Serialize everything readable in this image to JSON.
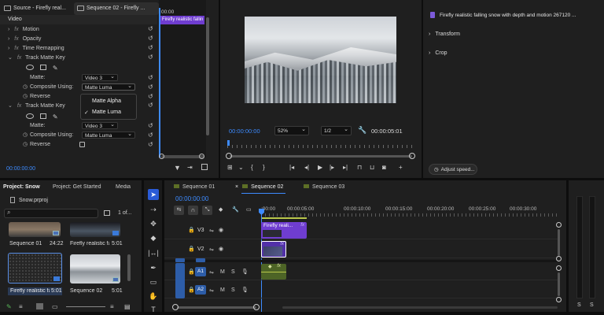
{
  "source_panel": {
    "tab_source": "Source - Firefly real...",
    "tab_sequence": "Sequence 02 - Firefly ...",
    "section_video": "Video",
    "effects": [
      {
        "label": "Motion"
      },
      {
        "label": "Opacity"
      },
      {
        "label": "Time Remapping"
      },
      {
        "label": "Track Matte Key"
      }
    ],
    "matte_label": "Matte:",
    "matte_value": "Video 3",
    "composite_label": "Composite Using:",
    "composite_value": "Matte Luma",
    "reverse_label": "Reverse",
    "track_matte_2": "Track Matte Key",
    "matte_value_2": "Video 3",
    "composite_value_2": "Matte Luma",
    "menu_items": [
      "Matte Alpha",
      "Matte Luma"
    ],
    "menu_checked": "Matte Luma",
    "timecode": "00:00:00:00",
    "mini_time": "00:00",
    "mini_clip": "Firefly realistic fallin"
  },
  "program": {
    "timecode": "00:00:00:00",
    "zoom": "52%",
    "resolution": "1/2",
    "duration": "00:00:05:01"
  },
  "properties": {
    "clip_title": "Firefly realistic falling snow with depth and motion 267120 ...",
    "sections": [
      "Transform",
      "Crop"
    ],
    "adjust_speed": "Adjust speed..."
  },
  "project": {
    "tabs": [
      "Project: Snow",
      "Project: Get Started",
      "Media"
    ],
    "file": "Snow.prproj",
    "count": "1 of...",
    "items": [
      {
        "name": "Sequence 01",
        "duration": "24:22"
      },
      {
        "name": "Firefly realistic falli...",
        "duration": "5:01"
      },
      {
        "name": "Firefly realistic fall...",
        "duration": "5:01"
      },
      {
        "name": "Sequence 02",
        "duration": "5:01"
      }
    ]
  },
  "timeline": {
    "tabs": [
      "Sequence 01",
      "Sequence 02",
      "Sequence 03"
    ],
    "active_tab": "Sequence 02",
    "timecode": "00:00:00:00",
    "ruler": [
      ":00:00",
      "00:00:05:00",
      "00:00:10:00",
      "00:00:15:00",
      "00:00:20:00",
      "00:00:25:00",
      "00:00:30:00"
    ],
    "tracks": [
      {
        "name": "V3"
      },
      {
        "name": "V2"
      },
      {
        "name": "A1",
        "source": "A1"
      },
      {
        "name": "A2",
        "source": "A2"
      }
    ],
    "clip_v3": "Firefly reali...",
    "mute": "M",
    "solo": "S"
  },
  "meter": {
    "labels": [
      "S",
      "S"
    ]
  },
  "colors": {
    "accent_blue": "#3d8bff",
    "clip_purple": "#6f3dd0",
    "audio_green": "#5d7a2e"
  }
}
